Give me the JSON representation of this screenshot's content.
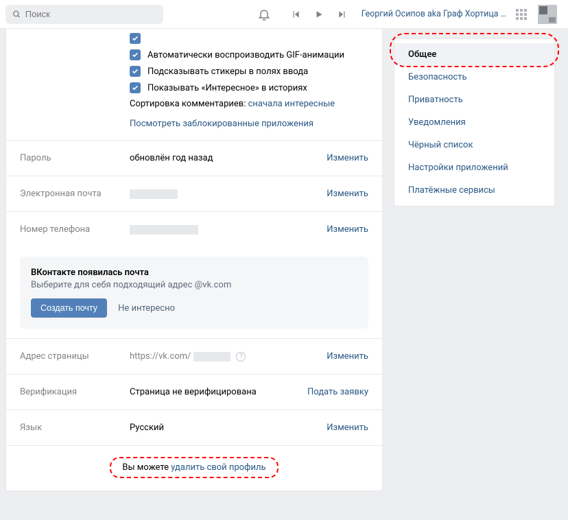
{
  "header": {
    "search_placeholder": "Поиск",
    "track_title": "Георгий Осипов aka Граф Хортица …"
  },
  "checkboxes": {
    "gif": "Автоматически воспроизводить GIF-анимации",
    "stickers": "Подсказывать стикеры в полях ввода",
    "interesting": "Показывать «Интересное» в историях"
  },
  "sort": {
    "label": "Сортировка комментариев: ",
    "value": "сначала интересные"
  },
  "blocked_apps_link": "Посмотреть заблокированные приложения",
  "fields": {
    "password_label": "Пароль",
    "password_value": "обновлён год назад",
    "email_label": "Электронная почта",
    "phone_label": "Номер телефона",
    "address_label": "Адрес страницы",
    "address_prefix": "https://vk.com/",
    "verification_label": "Верификация",
    "verification_value": "Страница не верифицирована",
    "language_label": "Язык",
    "language_value": "Русский",
    "change": "Изменить",
    "submit_request": "Подать заявку"
  },
  "mail_banner": {
    "title": "ВКонтакте появилась почта",
    "subtitle": "Выберите для себя подходящий адрес @vk.com",
    "create": "Создать почту",
    "not_interested": "Не интересно"
  },
  "delete": {
    "prefix": "Вы можете ",
    "link": "удалить свой профиль"
  },
  "sidebar": {
    "items": [
      "Общее",
      "Безопасность",
      "Приватность",
      "Уведомления",
      "Чёрный список",
      "Настройки приложений",
      "Платёжные сервисы"
    ]
  }
}
